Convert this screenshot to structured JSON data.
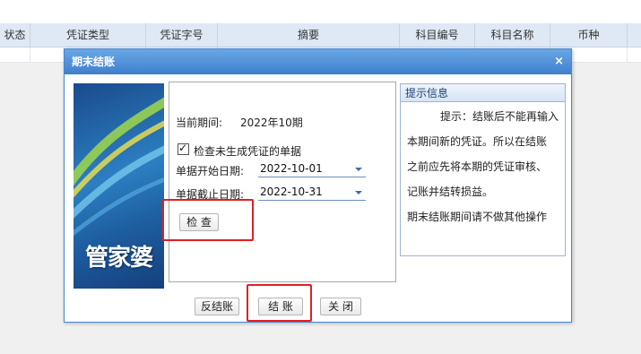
{
  "grid": {
    "columns": [
      "状态",
      "凭证类型",
      "凭证字号",
      "摘要",
      "科目编号",
      "科目名称",
      "币种"
    ]
  },
  "dialog": {
    "title": "期末结账",
    "close_icon": "close-icon",
    "brand": "管家婆",
    "period_label": "当前期间:",
    "period_value": "2022年10期",
    "check_label": "检查未生成凭证的单据",
    "check_checked": true,
    "start_label": "单据开始日期:",
    "start_value": "2022-10-01",
    "end_label": "单据截止日期:",
    "end_value": "2022-10-31",
    "check_button": "检 查",
    "hint_title": "提示信息",
    "hint_lines": [
      "提示：结账后不能再输入",
      "本期间新的凭证。所以在结账",
      "之前应先将本期的凭证审核、",
      "记账并结转损益。",
      "期末结账期间请不做其他操作"
    ],
    "unclose_button": "反结账",
    "close_button": "结 账",
    "exit_button": "关 闭"
  },
  "colors": {
    "title_bar": "#3f7fcb",
    "highlight": "#e02020",
    "grid_header": "#dfe8f5"
  }
}
